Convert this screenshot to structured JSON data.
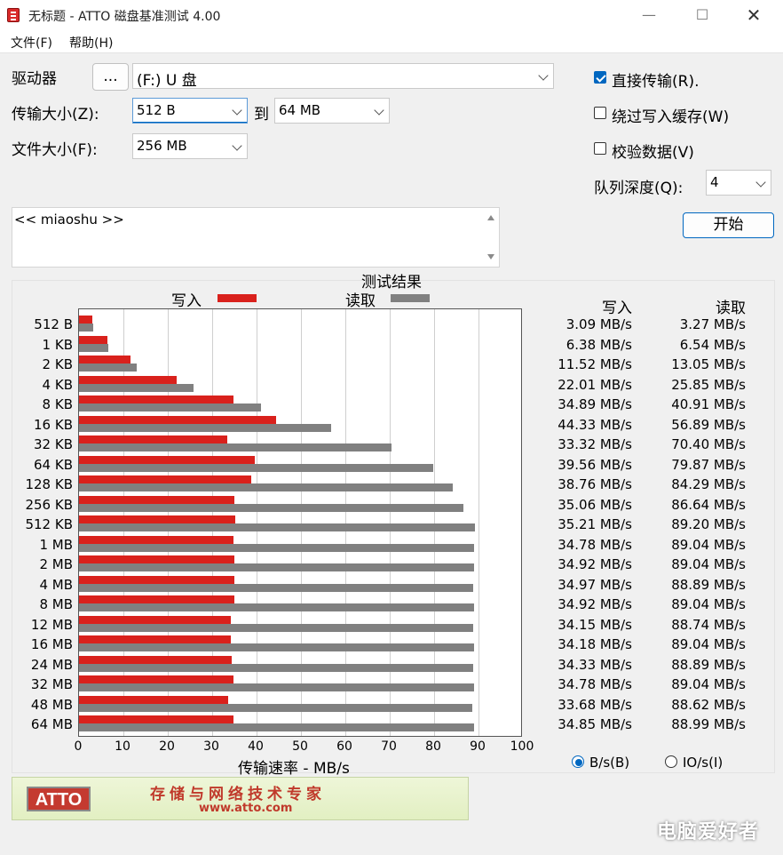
{
  "window": {
    "title": "无标题 - ATTO 磁盘基准测试 4.00"
  },
  "menu": {
    "file": "文件(F)",
    "help": "帮助(H)"
  },
  "controls": {
    "drive_label": "驱动器",
    "browse_label": "...",
    "drive_value": "(F:) U 盘",
    "transfer_label": "传输大小(Z):",
    "transfer_from": "512 B",
    "to_label": "到",
    "transfer_to": "64 MB",
    "filesize_label": "文件大小(F):",
    "filesize_value": "256 MB",
    "direct_io_label": "直接传输(R).",
    "direct_io_checked": true,
    "bypass_cache_label": "绕过写入缓存(W)",
    "bypass_cache_checked": false,
    "verify_label": "校验数据(V)",
    "verify_checked": false,
    "queue_label": "队列深度(Q):",
    "queue_value": "4",
    "start_label": "开始",
    "description": "<< miaoshu >>"
  },
  "results": {
    "title": "测试结果",
    "write_label": "写入",
    "read_label": "读取",
    "col_write": "写入",
    "col_read": "读取",
    "xaxis_label": "传输速率 - MB/s",
    "unit_bs": "B/s(B)",
    "unit_ios": "IO/s(I)",
    "unit_selected": "bs"
  },
  "chart_data": {
    "type": "bar",
    "orientation": "horizontal",
    "xlim": [
      0,
      100
    ],
    "xticks": [
      "0",
      "10",
      "20",
      "30",
      "40",
      "50",
      "60",
      "70",
      "80",
      "90",
      "100"
    ],
    "xlabel": "传输速率 - MB/s",
    "colors": {
      "write": "#d9211c",
      "read": "#808080"
    },
    "categories": [
      "512 B",
      "1 KB",
      "2 KB",
      "4 KB",
      "8 KB",
      "16 KB",
      "32 KB",
      "64 KB",
      "128 KB",
      "256 KB",
      "512 KB",
      "1 MB",
      "2 MB",
      "4 MB",
      "8 MB",
      "12 MB",
      "16 MB",
      "24 MB",
      "32 MB",
      "48 MB",
      "64 MB"
    ],
    "series": [
      {
        "name": "写入",
        "values": [
          3.09,
          6.38,
          11.52,
          22.01,
          34.89,
          44.33,
          33.32,
          39.56,
          38.76,
          35.06,
          35.21,
          34.78,
          34.92,
          34.97,
          34.92,
          34.15,
          34.18,
          34.33,
          34.78,
          33.68,
          34.85
        ],
        "labels": [
          "3.09 MB/s",
          "6.38 MB/s",
          "11.52 MB/s",
          "22.01 MB/s",
          "34.89 MB/s",
          "44.33 MB/s",
          "33.32 MB/s",
          "39.56 MB/s",
          "38.76 MB/s",
          "35.06 MB/s",
          "35.21 MB/s",
          "34.78 MB/s",
          "34.92 MB/s",
          "34.97 MB/s",
          "34.92 MB/s",
          "34.15 MB/s",
          "34.18 MB/s",
          "34.33 MB/s",
          "34.78 MB/s",
          "33.68 MB/s",
          "34.85 MB/s"
        ]
      },
      {
        "name": "读取",
        "values": [
          3.27,
          6.54,
          13.05,
          25.85,
          40.91,
          56.89,
          70.4,
          79.87,
          84.29,
          86.64,
          89.2,
          89.04,
          89.04,
          88.89,
          89.04,
          88.74,
          89.04,
          88.89,
          89.04,
          88.62,
          88.99
        ],
        "labels": [
          "3.27 MB/s",
          "6.54 MB/s",
          "13.05 MB/s",
          "25.85 MB/s",
          "40.91 MB/s",
          "56.89 MB/s",
          "70.40 MB/s",
          "79.87 MB/s",
          "84.29 MB/s",
          "86.64 MB/s",
          "89.20 MB/s",
          "89.04 MB/s",
          "89.04 MB/s",
          "88.89 MB/s",
          "89.04 MB/s",
          "88.74 MB/s",
          "89.04 MB/s",
          "88.89 MB/s",
          "89.04 MB/s",
          "88.62 MB/s",
          "88.99 MB/s"
        ]
      }
    ]
  },
  "banner": {
    "logo": "ATTO",
    "slogan": "存储与网络技术专家",
    "url": "www.atto.com"
  },
  "watermark": "电脑爱好者"
}
